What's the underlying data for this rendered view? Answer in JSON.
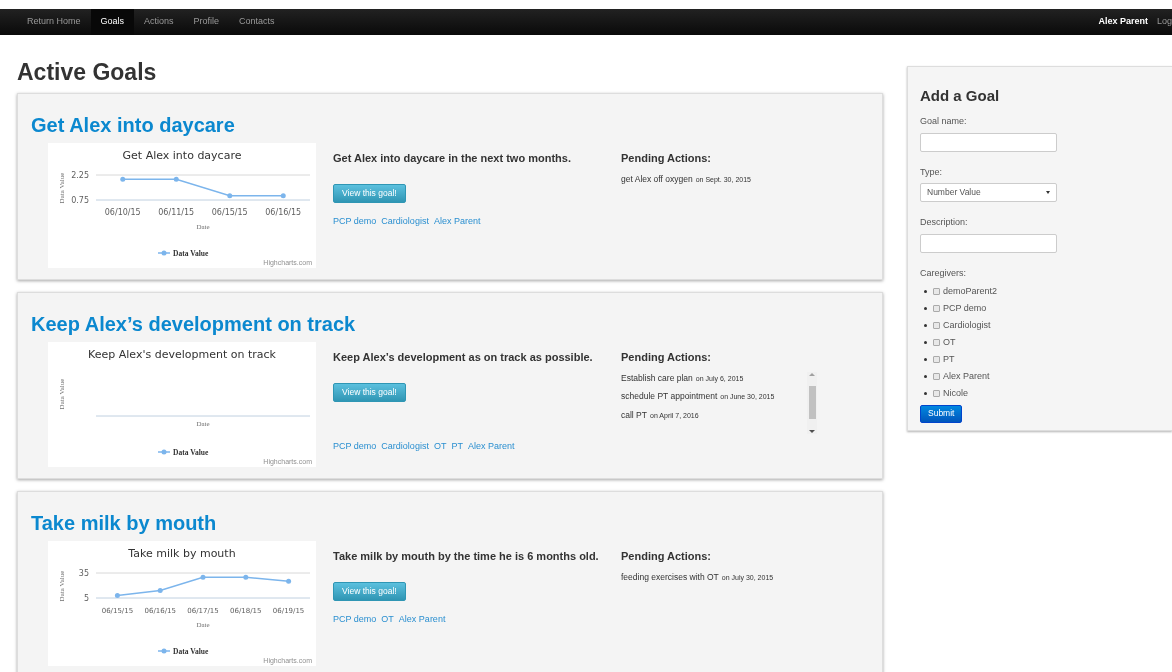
{
  "navbar": {
    "items": [
      {
        "label": "Return Home",
        "selected": false
      },
      {
        "label": "Goals",
        "selected": true
      },
      {
        "label": "Actions",
        "selected": false
      },
      {
        "label": "Profile",
        "selected": false
      },
      {
        "label": "Contacts",
        "selected": false
      }
    ],
    "user": "Alex Parent",
    "logout": "Log"
  },
  "page_title": "Active Goals",
  "goals": [
    {
      "title": "Get Alex into daycare",
      "description": "Get Alex into daycare in the next two months.",
      "button": "View this goal!",
      "caregivers": [
        "PCP demo",
        "Cardiologist",
        "Alex Parent"
      ],
      "pending_title": "Pending Actions:",
      "scrollable": false,
      "actions": [
        {
          "text": "get Alex off oxygen",
          "date": "on Sept. 30, 2015"
        }
      ],
      "chart_data": {
        "type": "line",
        "title": "Get Alex into daycare",
        "xlabel": "Date",
        "ylabel": "Data Value",
        "categories": [
          "06/10/15",
          "06/11/15",
          "06/15/15",
          "06/16/15"
        ],
        "series": [
          {
            "name": "Data Value",
            "color": "#7cb5ec",
            "values": [
              2,
              2,
              1,
              1
            ]
          }
        ],
        "yticks": [
          0.75,
          2.25
        ],
        "ylim": [
          0.75,
          2.25
        ]
      },
      "credit": "Highcharts.com"
    },
    {
      "title": "Keep Alex’s development on track",
      "description": "Keep Alex’s development as on track as possible.",
      "button": "View this goal!",
      "caregivers": [
        "PCP demo",
        "Cardiologist",
        "OT",
        "PT",
        "Alex Parent"
      ],
      "pending_title": "Pending Actions:",
      "scrollable": true,
      "actions": [
        {
          "text": "Establish care plan",
          "date": "on July 6, 2015"
        },
        {
          "text": "schedule PT appointment",
          "date": "on June 30, 2015"
        },
        {
          "text": "call PT",
          "date": "on April 7, 2016"
        }
      ],
      "chart": {
        "title": "Keep Alex's development on track",
        "xlabel": "Date",
        "ylabel": "Data Value",
        "legend": "Data Value"
      },
      "credit": "Highcharts.com"
    },
    {
      "title": "Take milk by mouth",
      "description": "Take milk by mouth by the time he is 6 months old.",
      "button": "View this goal!",
      "caregivers": [
        "PCP demo",
        "OT",
        "Alex Parent"
      ],
      "pending_title": "Pending Actions:",
      "scrollable": false,
      "actions": [
        {
          "text": "feeding exercises with OT",
          "date": "on July 30, 2015"
        }
      ],
      "chart_data": {
        "type": "line",
        "title": "Take milk by mouth",
        "xlabel": "Date",
        "ylabel": "Data Value",
        "categories": [
          "06/15/15",
          "06/16/15",
          "06/17/15",
          "06/18/15",
          "06/19/15"
        ],
        "series": [
          {
            "name": "Data Value",
            "color": "#7cb5ec",
            "values": [
              8,
              14,
              30,
              30,
              25
            ]
          }
        ],
        "yticks": [
          5,
          35
        ],
        "ylim": [
          5,
          35
        ]
      },
      "credit": "Highcharts.com"
    }
  ],
  "add_goal": {
    "title": "Add a Goal",
    "goal_name_label": "Goal name:",
    "type_label": "Type:",
    "type_value": "Number Value",
    "description_label": "Description:",
    "caregivers_label": "Caregivers:",
    "caregivers": [
      {
        "name": "demoParent2",
        "checked": false
      },
      {
        "name": "PCP demo",
        "checked": false
      },
      {
        "name": "Cardiologist",
        "checked": false
      },
      {
        "name": "OT",
        "checked": false
      },
      {
        "name": "PT",
        "checked": false
      },
      {
        "name": "Alex Parent",
        "checked": false
      },
      {
        "name": "Nicole",
        "checked": false
      }
    ],
    "submit": "Submit"
  }
}
